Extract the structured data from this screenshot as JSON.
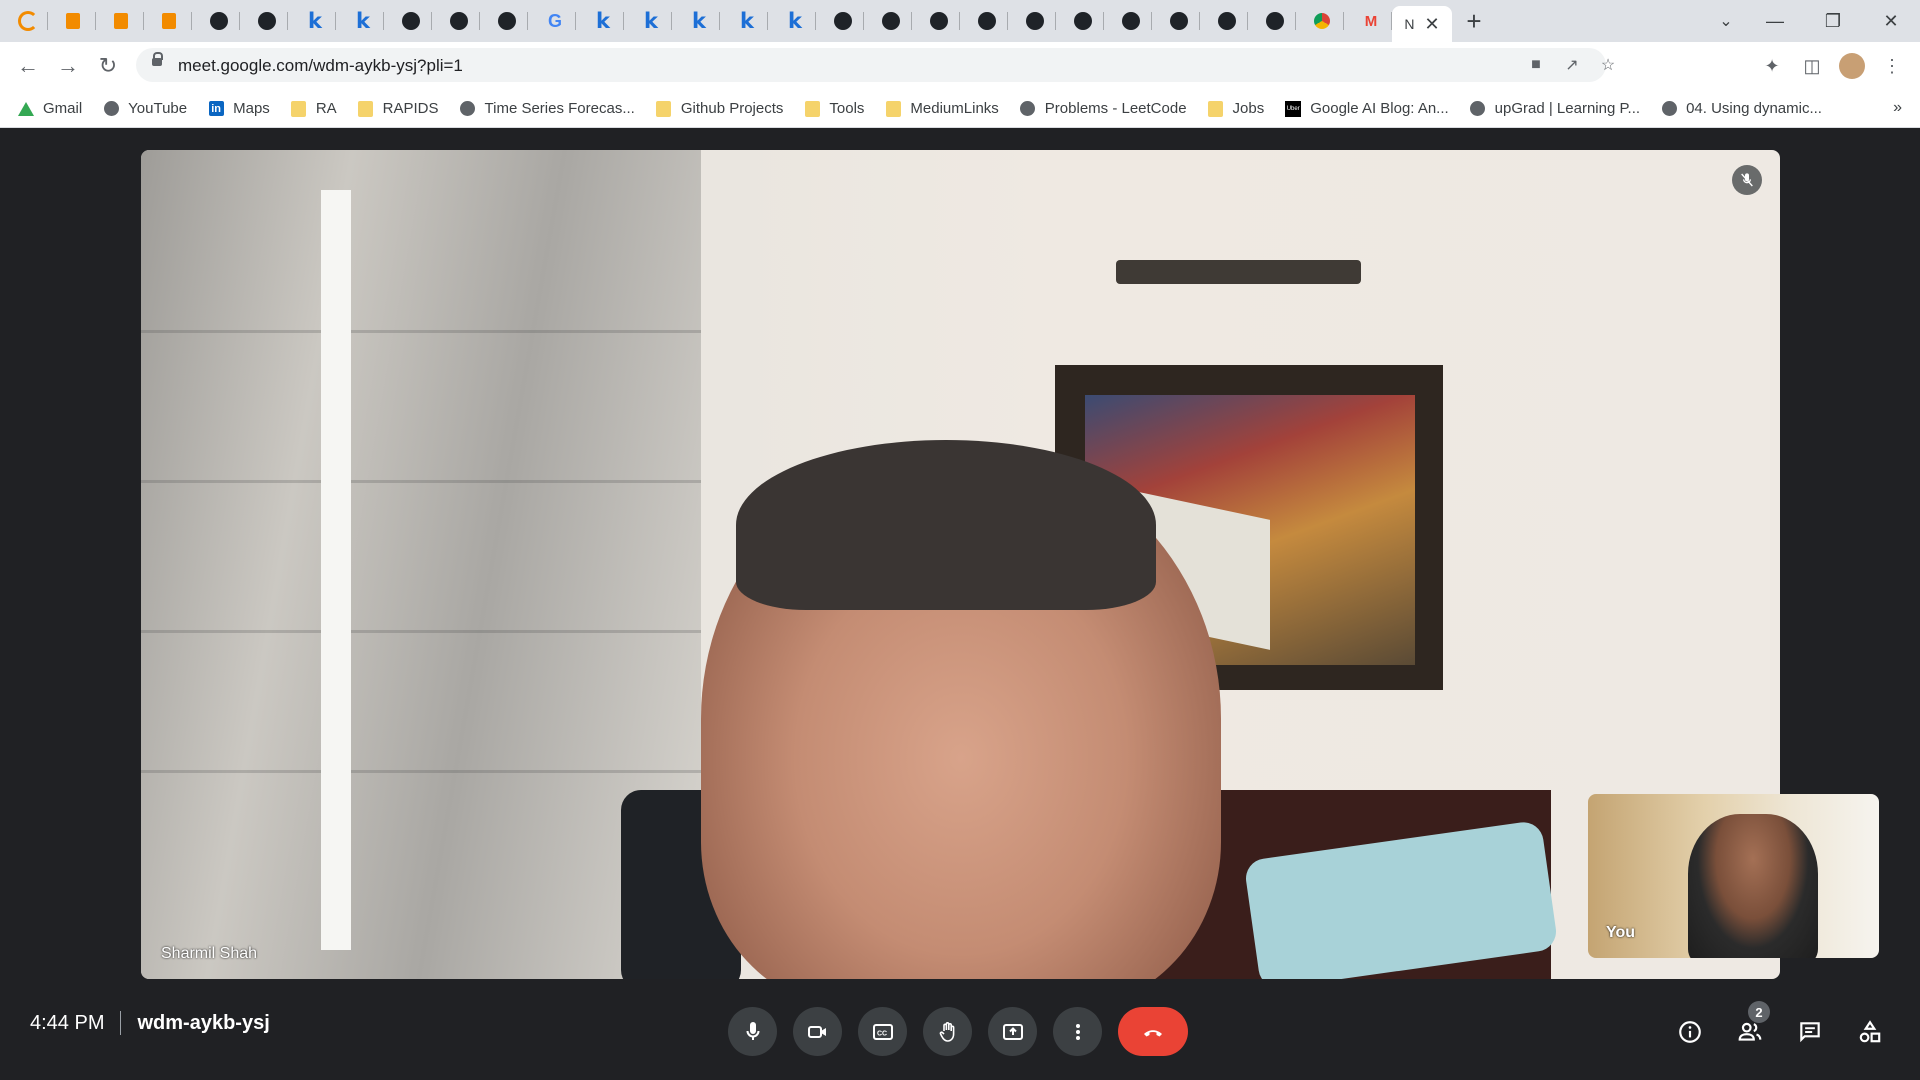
{
  "browser": {
    "tabs": [
      {
        "icon": "ring-icon"
      },
      {
        "icon": "book-icon"
      },
      {
        "icon": "book-icon"
      },
      {
        "icon": "book-icon"
      },
      {
        "icon": "github-icon"
      },
      {
        "icon": "github-icon"
      },
      {
        "icon": "k-icon"
      },
      {
        "icon": "k-icon"
      },
      {
        "icon": "github-icon"
      },
      {
        "icon": "github-icon"
      },
      {
        "icon": "github-icon"
      },
      {
        "icon": "google-icon"
      },
      {
        "icon": "k-icon"
      },
      {
        "icon": "k-icon"
      },
      {
        "icon": "k-icon"
      },
      {
        "icon": "k-icon"
      },
      {
        "icon": "k-icon"
      },
      {
        "icon": "github-icon"
      },
      {
        "icon": "github-icon"
      },
      {
        "icon": "github-icon"
      },
      {
        "icon": "github-icon"
      },
      {
        "icon": "github-icon"
      },
      {
        "icon": "github-icon"
      },
      {
        "icon": "github-icon"
      },
      {
        "icon": "github-icon"
      },
      {
        "icon": "github-icon"
      },
      {
        "icon": "github-icon"
      },
      {
        "icon": "chrome-icon"
      },
      {
        "icon": "gmail-icon"
      }
    ],
    "active_tab": {
      "label": "N",
      "close": "✕"
    },
    "new_tab": "+",
    "url": "meet.google.com/wdm-aykb-ysj?pli=1",
    "bookmarks": [
      {
        "label": "Gmail",
        "icon": "drive-icon"
      },
      {
        "label": "YouTube",
        "icon": "globe-icon"
      },
      {
        "label": "Maps",
        "icon": "linkedin-icon"
      },
      {
        "label": "RA",
        "icon": "folder-icon"
      },
      {
        "label": "RAPIDS",
        "icon": "folder-icon"
      },
      {
        "label": "Time Series Forecas...",
        "icon": "globe-icon"
      },
      {
        "label": "Github Projects",
        "icon": "folder-icon"
      },
      {
        "label": "Tools",
        "icon": "folder-icon"
      },
      {
        "label": "MediumLinks",
        "icon": "folder-icon"
      },
      {
        "label": "Problems - LeetCode",
        "icon": "globe-icon"
      },
      {
        "label": "Jobs",
        "icon": "folder-icon"
      },
      {
        "label": "Google AI Blog: An...",
        "icon": "uber-icon"
      },
      {
        "label": "upGrad | Learning P...",
        "icon": "globe-icon"
      },
      {
        "label": "04. Using dynamic...",
        "icon": "globe-icon"
      }
    ],
    "bookmarks_more": "»"
  },
  "meet": {
    "main_participant": "Sharmil Shah",
    "self_label": "You",
    "time": "4:44 PM",
    "meeting_code": "wdm-aykb-ysj",
    "participant_count": "2",
    "end_call_color": "#ea4335"
  }
}
